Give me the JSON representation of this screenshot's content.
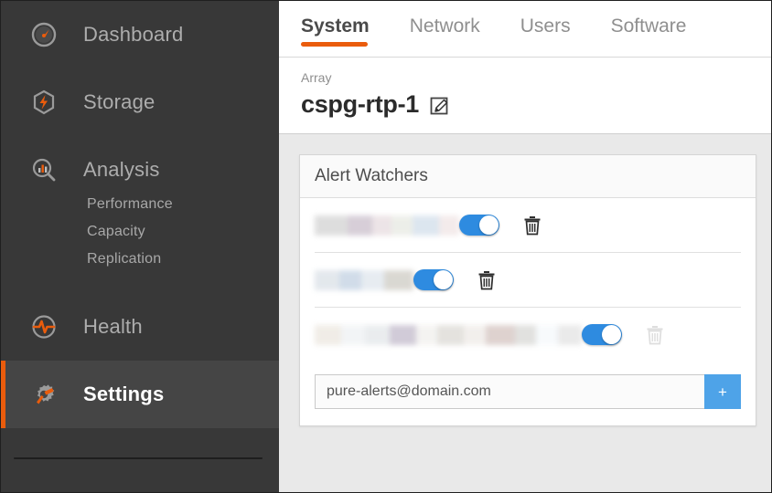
{
  "sidebar": {
    "items": [
      {
        "label": "Dashboard",
        "icon": "gauge-icon",
        "active": false
      },
      {
        "label": "Storage",
        "icon": "storage-bolt-icon",
        "active": false
      },
      {
        "label": "Analysis",
        "icon": "analysis-magnifier-icon",
        "active": false
      },
      {
        "label": "Health",
        "icon": "health-pulse-icon",
        "active": false
      },
      {
        "label": "Settings",
        "icon": "settings-gear-wrench-icon",
        "active": true
      }
    ],
    "subitems": [
      "Performance",
      "Capacity",
      "Replication"
    ],
    "accent_color": "#ea5c0c",
    "background_color": "#383838",
    "active_background_color": "#454545"
  },
  "tabs": [
    {
      "label": "System",
      "active": true
    },
    {
      "label": "Network",
      "active": false
    },
    {
      "label": "Users",
      "active": false
    },
    {
      "label": "Software",
      "active": false
    }
  ],
  "header": {
    "breadcrumb": "Array",
    "array_name": "cspg-rtp-1",
    "edit_icon": "edit-pencil-square-icon"
  },
  "card": {
    "title": "Alert Watchers",
    "rows": [
      {
        "email": "(redacted)",
        "enabled": true,
        "delete_enabled": true
      },
      {
        "email": "(redacted)",
        "enabled": true,
        "delete_enabled": true
      },
      {
        "email": "(redacted)",
        "enabled": true,
        "delete_enabled": false
      }
    ],
    "toggle_color": "#2e8be0",
    "add_input_value": "pure-alerts@domain.com",
    "add_input_placeholder": "pure-alerts@domain.com",
    "add_button_label": "+",
    "add_button_color": "#4ea3e8"
  }
}
